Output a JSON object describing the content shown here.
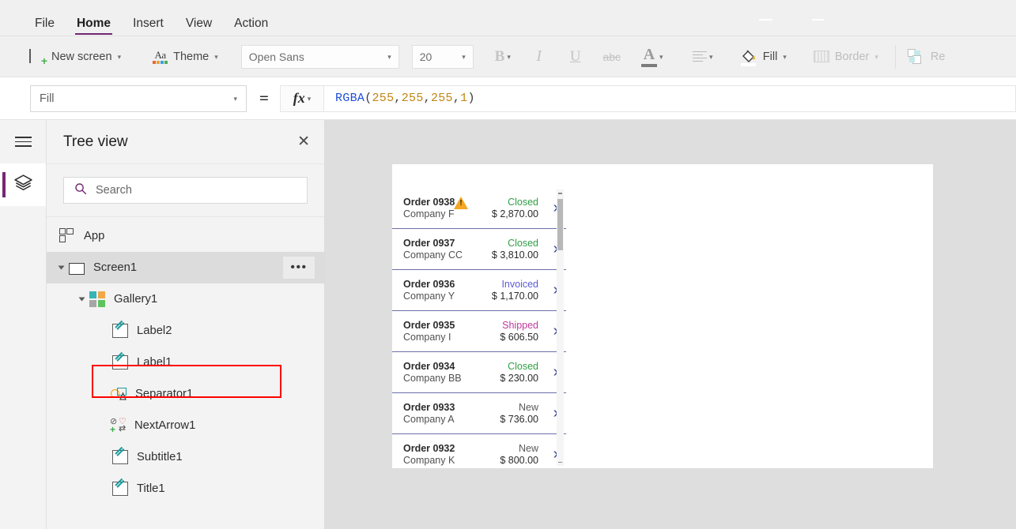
{
  "menubar": {
    "items": [
      {
        "label": "File",
        "active": false
      },
      {
        "label": "Home",
        "active": true
      },
      {
        "label": "Insert",
        "active": false
      },
      {
        "label": "View",
        "active": false
      },
      {
        "label": "Action",
        "active": false
      }
    ]
  },
  "ribbon": {
    "new_screen": "New screen",
    "theme": "Theme",
    "font_family": "Open Sans",
    "font_size": "20",
    "bold": "B",
    "italic": "I",
    "underline": "U",
    "strikethrough": "abc",
    "font_color": "A",
    "fill": "Fill",
    "border": "Border",
    "reorder": "Re"
  },
  "formulabar": {
    "property": "Fill",
    "equals": "=",
    "fx": "fx",
    "formula_fn": "RGBA",
    "formula_open": "(",
    "formula_args": [
      "255",
      "255",
      "255",
      "1"
    ],
    "formula_sep": ", ",
    "formula_close": ")"
  },
  "treepanel": {
    "title": "Tree view",
    "close": "✕",
    "search_placeholder": "Search",
    "rows": [
      {
        "label": "App",
        "icon": "app-icon",
        "indent": 16,
        "twisty": false,
        "selected": false
      },
      {
        "label": "Screen1",
        "icon": "screen-icon",
        "indent": 16,
        "twisty": true,
        "selected": true
      },
      {
        "label": "Gallery1",
        "icon": "gallery-icon",
        "indent": 42,
        "twisty": true,
        "selected": false
      },
      {
        "label": "Label2",
        "icon": "label-icon",
        "indent": 83,
        "twisty": false,
        "selected": false
      },
      {
        "label": "Label1",
        "icon": "label-icon",
        "indent": 83,
        "twisty": false,
        "selected": false
      },
      {
        "label": "Separator1",
        "icon": "separator-icon",
        "indent": 83,
        "twisty": false,
        "selected": false
      },
      {
        "label": "NextArrow1",
        "icon": "nextarrow-icon",
        "indent": 83,
        "twisty": false,
        "selected": false
      },
      {
        "label": "Subtitle1",
        "icon": "label-icon",
        "indent": 83,
        "twisty": false,
        "selected": false
      },
      {
        "label": "Title1",
        "icon": "label-icon",
        "indent": 83,
        "twisty": false,
        "selected": false
      }
    ],
    "overflow_dots": "•••"
  },
  "canvas": {
    "gallery_rows": [
      {
        "title": "Order 0938",
        "company": "Company F",
        "status": "Closed",
        "status_color": "#2f9e44",
        "amount": "$ 2,870.00",
        "warning": true,
        "arrow": "›"
      },
      {
        "title": "Order 0937",
        "company": "Company CC",
        "status": "Closed",
        "status_color": "#2f9e44",
        "amount": "$ 3,810.00",
        "warning": false,
        "arrow": "›"
      },
      {
        "title": "Order 0936",
        "company": "Company Y",
        "status": "Invoiced",
        "status_color": "#5b5bd6",
        "amount": "$ 1,170.00",
        "warning": false,
        "arrow": "›"
      },
      {
        "title": "Order 0935",
        "company": "Company I",
        "status": "Shipped",
        "status_color": "#c0399f",
        "amount": "$ 606.50",
        "warning": false,
        "arrow": "›"
      },
      {
        "title": "Order 0934",
        "company": "Company BB",
        "status": "Closed",
        "status_color": "#2f9e44",
        "amount": "$ 230.00",
        "warning": false,
        "arrow": "›"
      },
      {
        "title": "Order 0933",
        "company": "Company A",
        "status": "New",
        "status_color": "#595959",
        "amount": "$ 736.00",
        "warning": false,
        "arrow": "›"
      },
      {
        "title": "Order 0932",
        "company": "Company K",
        "status": "New",
        "status_color": "#595959",
        "amount": "$ 800.00",
        "warning": false,
        "arrow": "›"
      }
    ]
  },
  "colors": {
    "accent_purple": "#742774",
    "selection_red": "#ff0000",
    "canvas_bg": "#dedede",
    "chrome_bg": "#f0f0f0",
    "row_divider": "#6b6fa8",
    "arrow_blue": "#34438f",
    "warning_amber": "#f5a623"
  }
}
